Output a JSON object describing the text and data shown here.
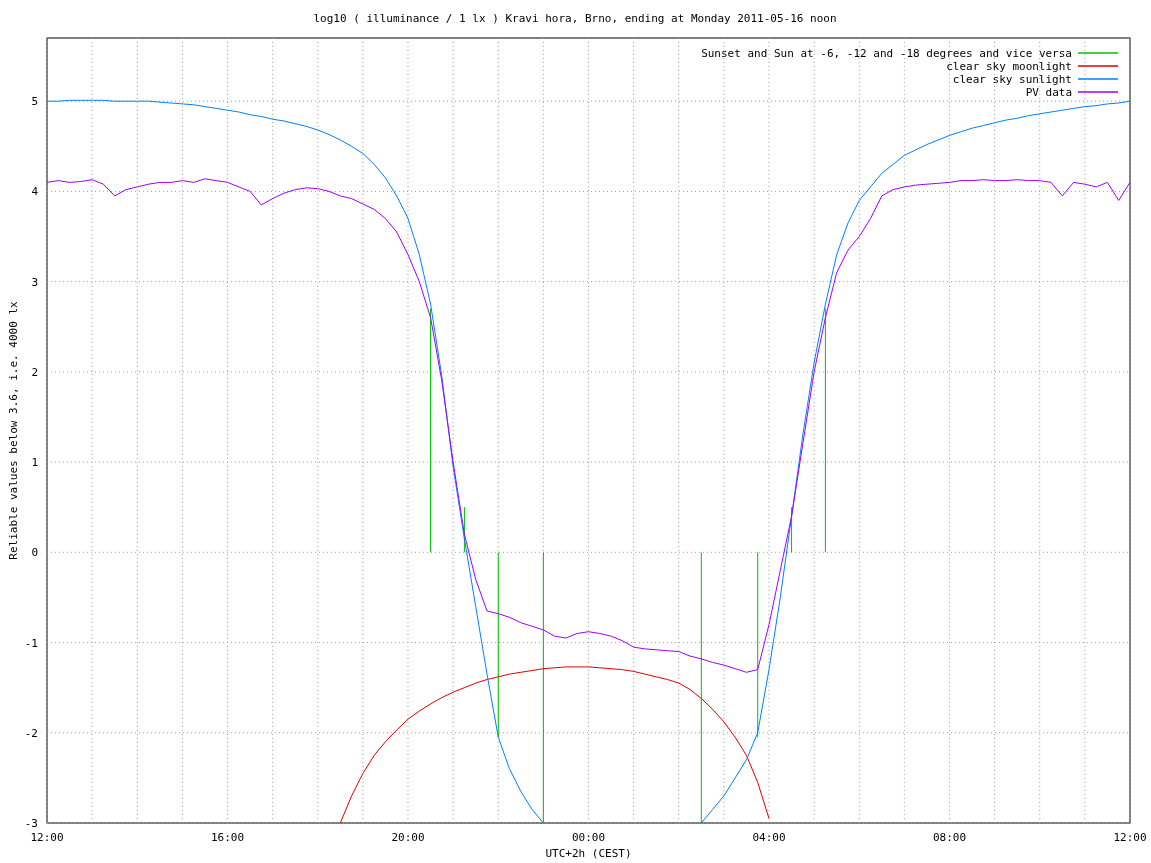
{
  "chart": {
    "chart_data": {
      "type": "line",
      "title": "log10 ( illuminance / 1 lx ) Kravi hora, Brno, ending at Monday 2011-05-16 noon",
      "xlabel": "UTC+2h (CEST)",
      "ylabel": "Reliable values below 3.6, i.e. 4000 lx",
      "categories": [
        "12:00",
        null,
        null,
        null,
        null,
        null,
        null,
        null,
        null,
        null,
        null,
        null,
        null,
        null,
        null,
        null,
        "16:00",
        null,
        null,
        null,
        null,
        null,
        null,
        null,
        null,
        null,
        null,
        null,
        null,
        null,
        null,
        null,
        "20:00",
        null,
        null,
        null,
        null,
        null,
        null,
        null,
        null,
        null,
        null,
        null,
        null,
        null,
        null,
        null,
        "00:00",
        null,
        null,
        null,
        null,
        null,
        null,
        null,
        null,
        null,
        null,
        null,
        null,
        null,
        null,
        null,
        "04:00",
        null,
        null,
        null,
        null,
        null,
        null,
        null,
        null,
        null,
        null,
        null,
        null,
        null,
        null,
        null,
        "08:00",
        null,
        null,
        null,
        null,
        null,
        null,
        null,
        null,
        null,
        null,
        null,
        null,
        null,
        null,
        null,
        "12:00"
      ],
      "series": [
        {
          "name": "Sunset and Sun at -6, -12 and -18 degrees and vice versa",
          "color": "#00c000",
          "type": "bar",
          "values": [
            null,
            null,
            null,
            null,
            null,
            null,
            null,
            null,
            null,
            null,
            null,
            null,
            null,
            null,
            null,
            null,
            null,
            null,
            null,
            null,
            null,
            null,
            null,
            null,
            null,
            null,
            null,
            null,
            null,
            null,
            null,
            null,
            null,
            null,
            2.7,
            null,
            null,
            0.5,
            null,
            null,
            -2.05,
            null,
            null,
            null,
            -3,
            null,
            null,
            null,
            null,
            null,
            null,
            null,
            null,
            null,
            null,
            null,
            null,
            null,
            -3,
            null,
            null,
            null,
            null,
            -2.05,
            null,
            null,
            0.5,
            null,
            null,
            2.7,
            null,
            null,
            null,
            null,
            null,
            null,
            null,
            null,
            null,
            null,
            null,
            null,
            null,
            null,
            null,
            null,
            null,
            null,
            null,
            null,
            null,
            null,
            null,
            null,
            null,
            null,
            null
          ]
        },
        {
          "name": "clear sky moonlight",
          "color": "#e00000",
          "values": [
            null,
            null,
            null,
            null,
            null,
            null,
            null,
            null,
            null,
            null,
            null,
            null,
            null,
            null,
            null,
            null,
            null,
            null,
            null,
            null,
            null,
            null,
            null,
            null,
            null,
            null,
            -3.0,
            -2.7,
            -2.45,
            -2.25,
            -2.1,
            -1.97,
            -1.85,
            -1.76,
            -1.68,
            -1.61,
            -1.55,
            -1.5,
            -1.45,
            -1.41,
            -1.38,
            -1.35,
            -1.33,
            -1.31,
            -1.29,
            -1.28,
            -1.27,
            -1.27,
            -1.27,
            -1.28,
            -1.29,
            -1.3,
            -1.32,
            -1.35,
            -1.38,
            -1.41,
            -1.45,
            -1.52,
            -1.62,
            -1.74,
            -1.88,
            -2.05,
            -2.25,
            -2.55,
            -2.95,
            null,
            null,
            null,
            null,
            null,
            null,
            null,
            null,
            null,
            null,
            null,
            null,
            null,
            null,
            null,
            null,
            null,
            null,
            null,
            null,
            null,
            null,
            null,
            null,
            null,
            null,
            null,
            null,
            null,
            null,
            null,
            null
          ]
        },
        {
          "name": "clear sky sunlight",
          "color": "#0080ff",
          "values": [
            5.0,
            5.0,
            5.01,
            5.01,
            5.01,
            5.01,
            5.0,
            5.0,
            5.0,
            5.0,
            4.99,
            4.98,
            4.97,
            4.96,
            4.94,
            4.92,
            4.9,
            4.88,
            4.85,
            4.83,
            4.8,
            4.78,
            4.75,
            4.72,
            4.68,
            4.63,
            4.57,
            4.5,
            4.42,
            4.3,
            4.15,
            3.95,
            3.7,
            3.3,
            2.75,
            1.95,
            0.95,
            0.15,
            -0.6,
            -1.35,
            -2.05,
            -2.4,
            -2.65,
            -2.85,
            -3.0,
            null,
            null,
            null,
            null,
            null,
            null,
            null,
            null,
            null,
            null,
            null,
            null,
            null,
            -3.0,
            -2.85,
            -2.7,
            -2.5,
            -2.3,
            -2.0,
            -1.3,
            -0.5,
            0.4,
            1.3,
            2.1,
            2.75,
            3.3,
            3.65,
            3.9,
            4.05,
            4.2,
            4.3,
            4.4,
            4.46,
            4.52,
            4.57,
            4.62,
            4.66,
            4.7,
            4.73,
            4.76,
            4.79,
            4.81,
            4.84,
            4.86,
            4.88,
            4.9,
            4.92,
            4.94,
            4.95,
            4.97,
            4.98,
            5.0
          ]
        },
        {
          "name": "PV data",
          "color": "#a000ff",
          "values": [
            4.1,
            4.12,
            4.1,
            4.11,
            4.13,
            4.08,
            3.95,
            4.02,
            4.05,
            4.08,
            4.1,
            4.1,
            4.12,
            4.1,
            4.14,
            4.12,
            4.1,
            4.05,
            4.0,
            3.85,
            3.92,
            3.98,
            4.02,
            4.04,
            4.03,
            4.0,
            3.95,
            3.92,
            3.86,
            3.8,
            3.7,
            3.55,
            3.3,
            3.0,
            2.6,
            1.9,
            1.0,
            0.2,
            -0.3,
            -0.65,
            -0.68,
            -0.72,
            -0.78,
            -0.82,
            -0.86,
            -0.93,
            -0.95,
            -0.9,
            -0.88,
            -0.9,
            -0.93,
            -0.98,
            -1.05,
            -1.07,
            -1.08,
            -1.09,
            -1.1,
            -1.15,
            -1.18,
            -1.22,
            -1.25,
            -1.29,
            -1.33,
            -1.3,
            -0.8,
            -0.2,
            0.4,
            1.2,
            2.0,
            2.6,
            3.1,
            3.35,
            3.5,
            3.7,
            3.95,
            4.02,
            4.05,
            4.07,
            4.08,
            4.09,
            4.1,
            4.12,
            4.12,
            4.13,
            4.12,
            4.12,
            4.13,
            4.12,
            4.12,
            4.1,
            3.95,
            4.1,
            4.08,
            4.05,
            4.1,
            3.9,
            4.1
          ]
        }
      ],
      "ylim": [
        -3,
        5.7
      ],
      "yticks": [
        -3,
        -2,
        -1,
        0,
        1,
        2,
        3,
        4,
        5
      ],
      "grid": true,
      "legend": true
    }
  }
}
